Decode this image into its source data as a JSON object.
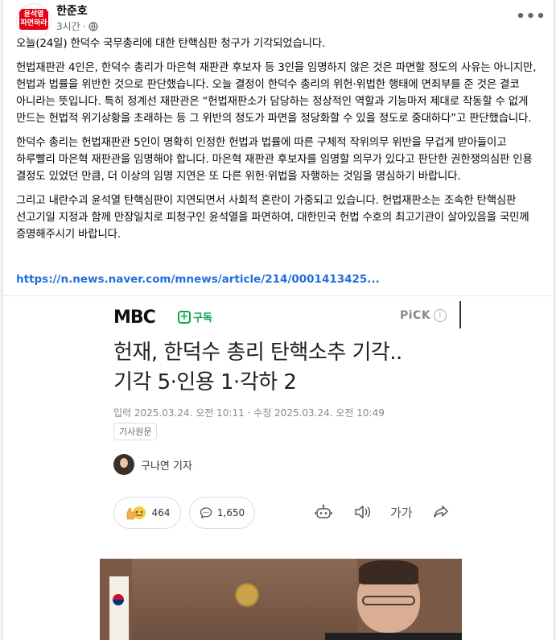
{
  "post": {
    "avatar_badge_line1": "윤석열",
    "avatar_badge_line2": "파면하라",
    "author": "한준호",
    "time": "3시간",
    "privacy_icon": "globe-icon",
    "more_icon": "•••",
    "paragraphs": [
      "오늘(24일) 한덕수 국무총리에 대한 탄핵심판 청구가 기각되었습니다.",
      "헌법재판관 4인은, 한덕수 총리가 마은혁 재판관 후보자 등 3인을 임명하지 않은 것은 파면할 정도의 사유는 아니지만, 헌법과 법률을 위반한 것으로 판단했습니다. 오늘 결정이 한덕수 총리의 위헌·위법한 행태에 면죄부를 준 것은 결코 아니라는 뜻입니다. 특히 정계선 재판관은 “헌법재판소가 담당하는 정상적인 역할과 기능마저 제대로 작동할 수 없게 만드는 헌법적 위기상황을 초래하는 등 그 위반의 정도가 파면을 정당화할 수 있을 정도로 중대하다”고 판단했습니다.",
      "한덕수 총리는 헌법재판관 5인이 명확히 인정한 헌법과 법률에 따른 구체적 작위의무 위반을 무겁게 받아들이고 하루빨리 마은혁 재판관을 임명해야 합니다. 마은혁 재판관 후보자를 임명할 의무가 있다고 판단한 권한쟁의심판 인용 결정도 있었던 만큼, 더 이상의 임명 지연은 또 다른 위헌·위법을 자행하는 것임을 명심하기 바랍니다.",
      "그리고 내란수괴 윤석열 탄핵심판이 지연되면서 사회적 혼란이 가중되고 있습니다. 헌법재판소는 조속한 탄핵심판 선고기일 지정과 함께 만장일치로 피청구인 윤석열을 파면하여, 대한민국 헌법 수호의 최고기관이 살아있음을 국민께 증명해주시기 바랍니다."
    ],
    "link": "https://n.news.naver.com/mnews/article/214/0001413425..."
  },
  "preview": {
    "logo": "MBC",
    "subscribe_label": "구독",
    "pick_label": "PiCK",
    "pick_info": "i",
    "headline_line1": "헌재, 한덕수 총리 탄핵소추 기각..",
    "headline_line2": "기각 5·인용 1·각하 2",
    "dates": "입력 2025.03.24. 오전 10:11 · 수정 2025.03.24. 오전 10:49",
    "source_tag": "기사원문",
    "reporter": "구나연 기자",
    "reaction_count": "464",
    "comment_count": "1,650",
    "font_size_label": "가가",
    "icons": [
      "reaction-icon",
      "comment-icon",
      "robot-icon",
      "speaker-icon",
      "font-size-icon",
      "share-icon"
    ]
  }
}
